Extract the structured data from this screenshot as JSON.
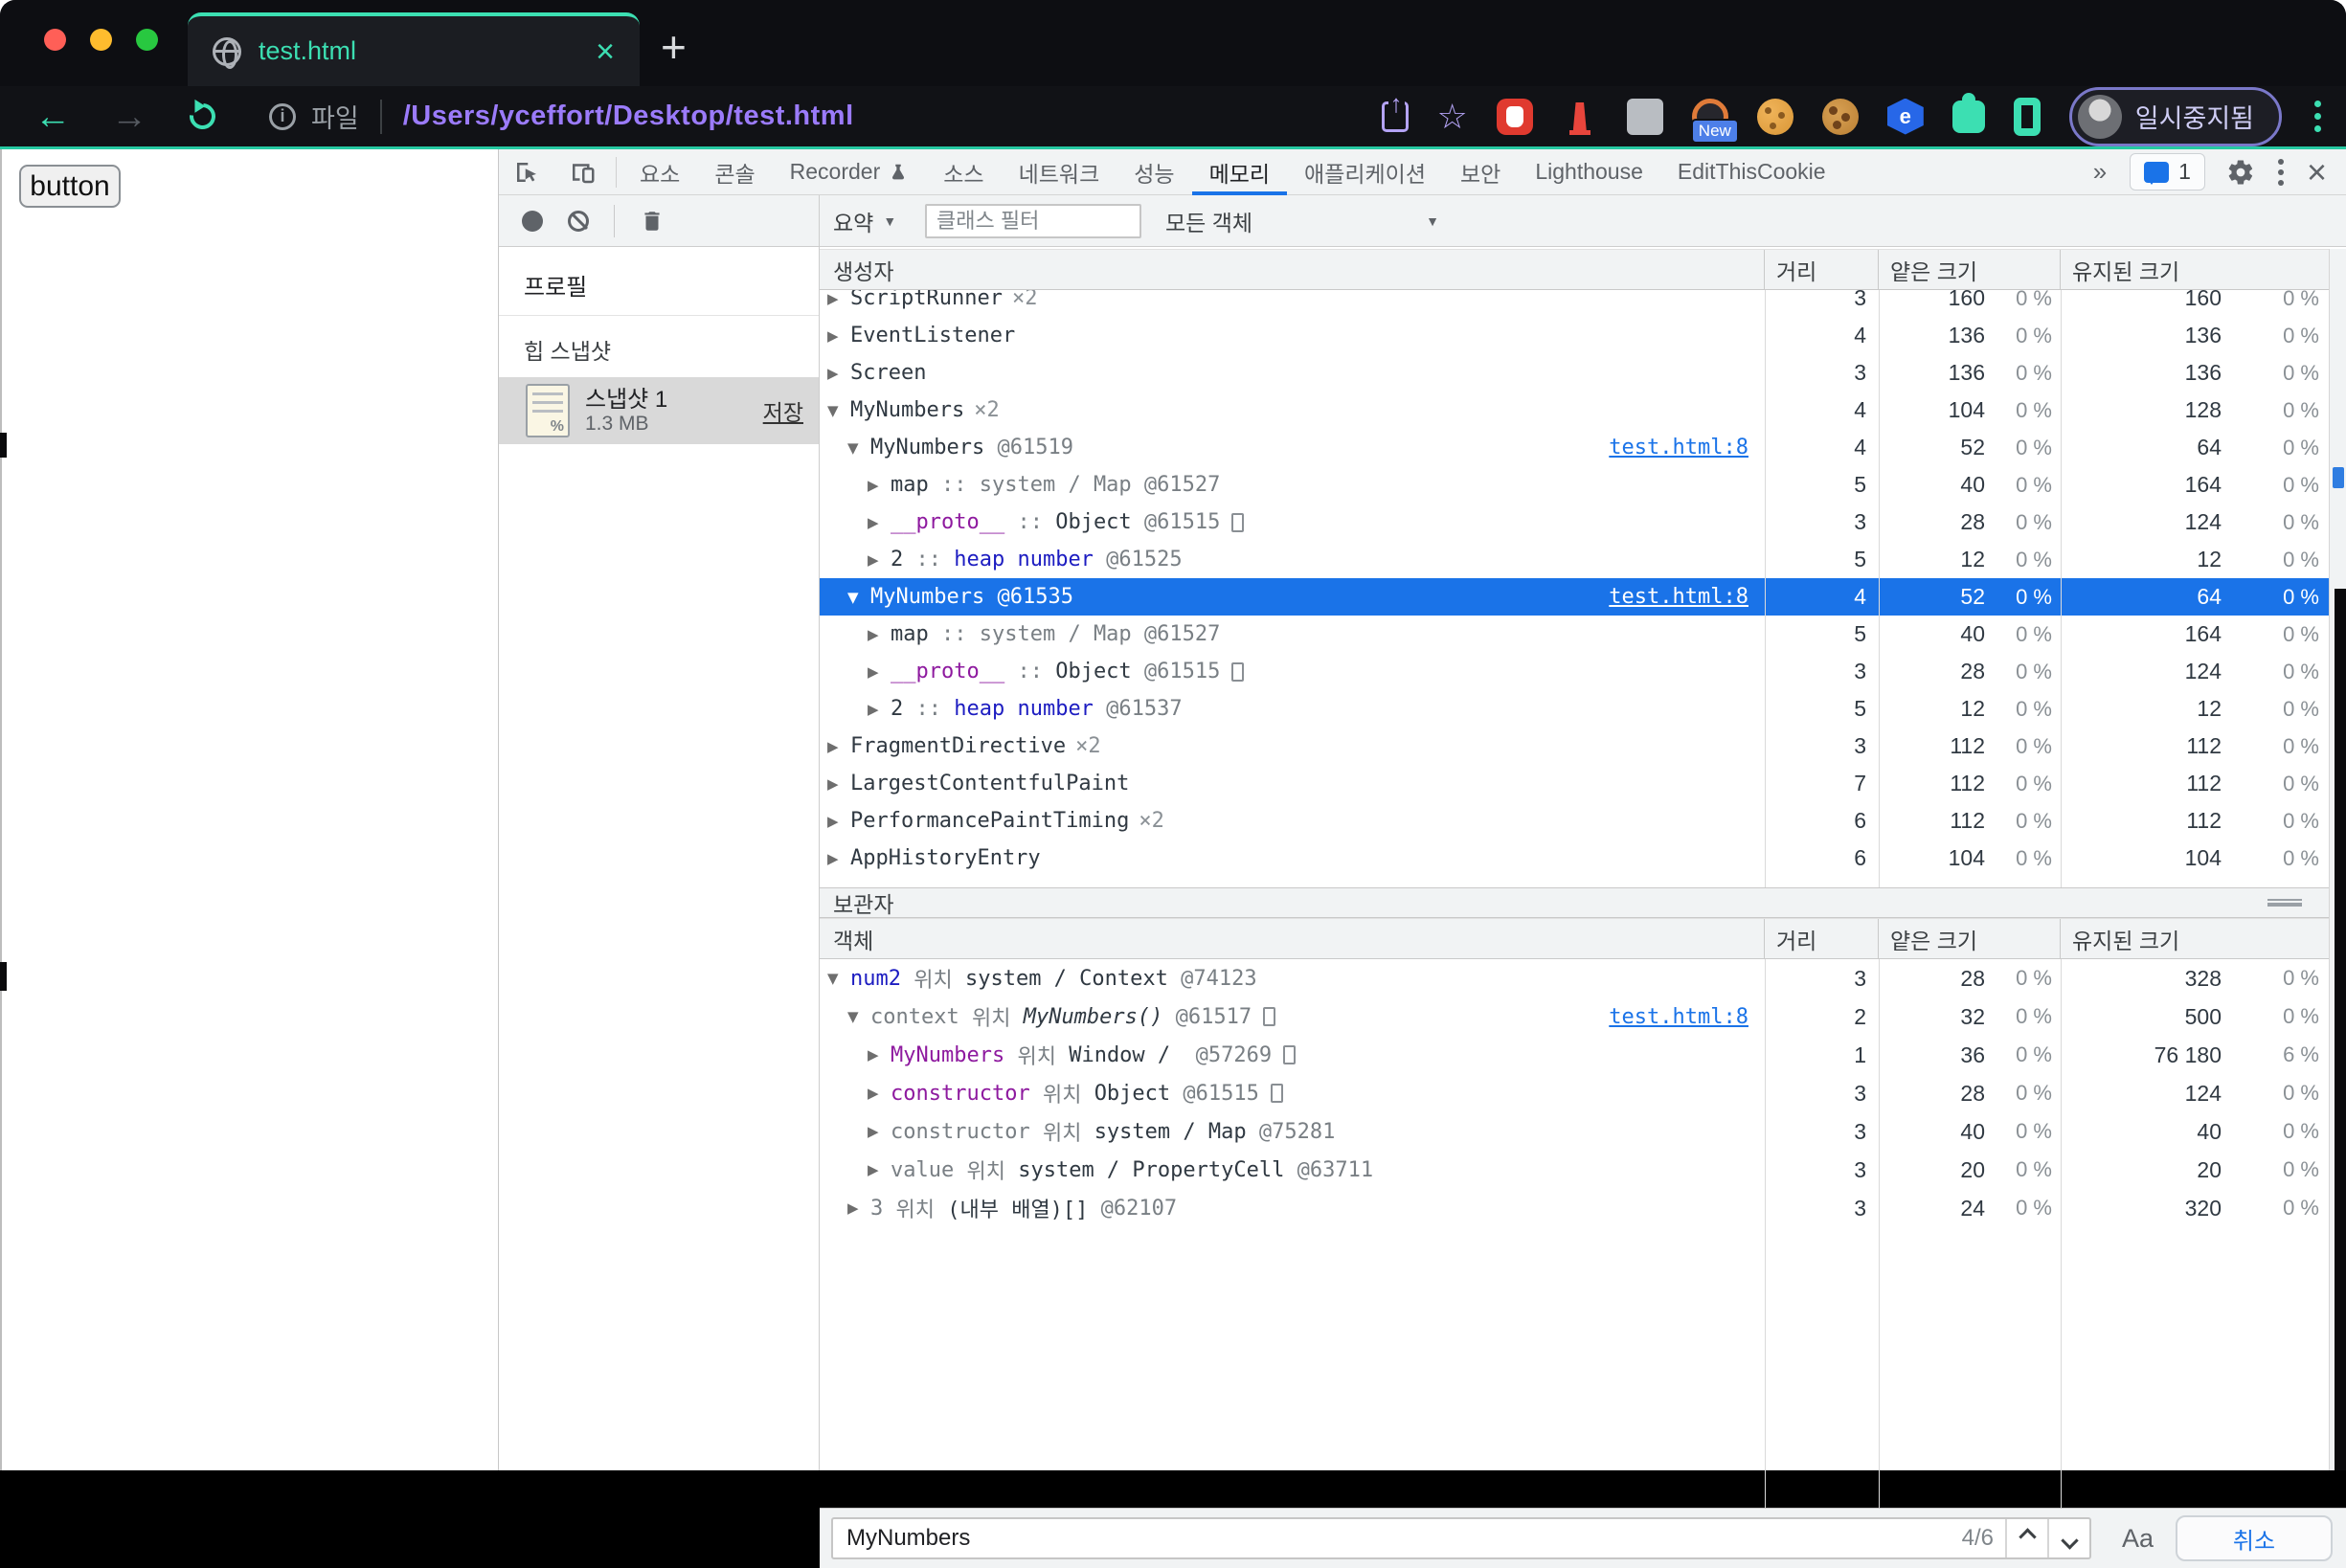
{
  "theme": {
    "accent_teal": "#3cdfb2",
    "url_purple": "#9b7bfa",
    "selection_blue": "#1a73e8"
  },
  "browser": {
    "tab_title": "test.html",
    "tab_close": "×",
    "new_tab_button": "+",
    "file_label": "파일",
    "url": "/Users/yceffort/Desktop/test.html",
    "profile_badge": "일시중지됨",
    "extension_new_badge": "New",
    "hexagon_ext_letter": "e"
  },
  "page": {
    "button_label": "button"
  },
  "devtools": {
    "tabs": [
      {
        "label": "요소"
      },
      {
        "label": "콘솔"
      },
      {
        "label": "Recorder",
        "icon": "flask"
      },
      {
        "label": "소스"
      },
      {
        "label": "네트워크"
      },
      {
        "label": "성능"
      },
      {
        "label": "메모리",
        "selected": true
      },
      {
        "label": "애플리케이션"
      },
      {
        "label": "보안"
      },
      {
        "label": "Lighthouse"
      },
      {
        "label": "EditThisCookie"
      }
    ],
    "overflow_chevron": "»",
    "issues_count": "1",
    "toolbar": {
      "summary_label": "요약",
      "class_filter_placeholder": "클래스 필터",
      "objects_filter_value": "모든 객체"
    },
    "sidebar": {
      "profiles_title": "프로필",
      "heap_snapshots_label": "힙 스냅샷",
      "snapshot_name": "스냅샷 1",
      "snapshot_size": "1.3 MB",
      "save_label": "저장"
    },
    "grid_columns": {
      "constructor": "생성자",
      "object": "객체",
      "distance": "거리",
      "shallow_size": "얕은 크기",
      "retained_size": "유지된 크기"
    },
    "retainers_title": "보관자",
    "constructor_rows": [
      {
        "lvl": 0,
        "arrow": "closed",
        "clipped": true,
        "parts": [
          [
            "ScriptRunner",
            "dk"
          ],
          [
            "×2",
            "cnt"
          ]
        ],
        "dist": "3",
        "shallow": "160",
        "shallow_pct": "0 %",
        "retained": "160",
        "retained_pct": "0 %"
      },
      {
        "lvl": 0,
        "arrow": "closed",
        "parts": [
          [
            "EventListener",
            "dk"
          ]
        ],
        "dist": "4",
        "shallow": "136",
        "shallow_pct": "0 %",
        "retained": "136",
        "retained_pct": "0 %"
      },
      {
        "lvl": 0,
        "arrow": "closed",
        "parts": [
          [
            "Screen",
            "dk"
          ]
        ],
        "dist": "3",
        "shallow": "136",
        "shallow_pct": "0 %",
        "retained": "136",
        "retained_pct": "0 %"
      },
      {
        "lvl": 0,
        "arrow": "open",
        "parts": [
          [
            "MyNumbers",
            "dk"
          ],
          [
            "×2",
            "cnt"
          ]
        ],
        "dist": "4",
        "shallow": "104",
        "shallow_pct": "0 %",
        "retained": "128",
        "retained_pct": "0 %"
      },
      {
        "lvl": 1,
        "arrow": "open",
        "link": "test.html:8",
        "parts": [
          [
            "MyNumbers",
            "dk"
          ],
          [
            " @61519",
            "gray"
          ]
        ],
        "dist": "4",
        "shallow": "52",
        "shallow_pct": "0 %",
        "retained": "64",
        "retained_pct": "0 %"
      },
      {
        "lvl": 2,
        "arrow": "closed",
        "parts": [
          [
            "map",
            "dk"
          ],
          [
            " :: ",
            "gray"
          ],
          [
            "system / Map",
            "gray"
          ],
          [
            " @61527",
            "gray"
          ]
        ],
        "dist": "5",
        "shallow": "40",
        "shallow_pct": "0 %",
        "retained": "164",
        "retained_pct": "0 %"
      },
      {
        "lvl": 2,
        "arrow": "closed",
        "box": true,
        "parts": [
          [
            "__proto__",
            "mag"
          ],
          [
            " :: ",
            "gray"
          ],
          [
            "Object",
            "dk"
          ],
          [
            " @61515",
            "gray"
          ]
        ],
        "dist": "3",
        "shallow": "28",
        "shallow_pct": "0 %",
        "retained": "124",
        "retained_pct": "0 %"
      },
      {
        "lvl": 2,
        "arrow": "closed",
        "parts": [
          [
            "2",
            "dk"
          ],
          [
            " :: ",
            "gray"
          ],
          [
            "heap number",
            "navy"
          ],
          [
            " @61525",
            "gray"
          ]
        ],
        "dist": "5",
        "shallow": "12",
        "shallow_pct": "0 %",
        "retained": "12",
        "retained_pct": "0 %"
      },
      {
        "lvl": 1,
        "arrow": "open",
        "selected": true,
        "link": "test.html:8",
        "parts": [
          [
            "MyNumbers",
            "dk"
          ],
          [
            " @61535",
            "gray"
          ]
        ],
        "dist": "4",
        "shallow": "52",
        "shallow_pct": "0 %",
        "retained": "64",
        "retained_pct": "0 %"
      },
      {
        "lvl": 2,
        "arrow": "closed",
        "parts": [
          [
            "map",
            "dk"
          ],
          [
            " :: ",
            "gray"
          ],
          [
            "system / Map",
            "gray"
          ],
          [
            " @61527",
            "gray"
          ]
        ],
        "dist": "5",
        "shallow": "40",
        "shallow_pct": "0 %",
        "retained": "164",
        "retained_pct": "0 %"
      },
      {
        "lvl": 2,
        "arrow": "closed",
        "box": true,
        "parts": [
          [
            "__proto__",
            "mag"
          ],
          [
            " :: ",
            "gray"
          ],
          [
            "Object",
            "dk"
          ],
          [
            " @61515",
            "gray"
          ]
        ],
        "dist": "3",
        "shallow": "28",
        "shallow_pct": "0 %",
        "retained": "124",
        "retained_pct": "0 %"
      },
      {
        "lvl": 2,
        "arrow": "closed",
        "parts": [
          [
            "2",
            "dk"
          ],
          [
            " :: ",
            "gray"
          ],
          [
            "heap number",
            "navy"
          ],
          [
            " @61537",
            "gray"
          ]
        ],
        "dist": "5",
        "shallow": "12",
        "shallow_pct": "0 %",
        "retained": "12",
        "retained_pct": "0 %"
      },
      {
        "lvl": 0,
        "arrow": "closed",
        "parts": [
          [
            "FragmentDirective",
            "dk"
          ],
          [
            "×2",
            "cnt"
          ]
        ],
        "dist": "3",
        "shallow": "112",
        "shallow_pct": "0 %",
        "retained": "112",
        "retained_pct": "0 %"
      },
      {
        "lvl": 0,
        "arrow": "closed",
        "parts": [
          [
            "LargestContentfulPaint",
            "dk"
          ]
        ],
        "dist": "7",
        "shallow": "112",
        "shallow_pct": "0 %",
        "retained": "112",
        "retained_pct": "0 %"
      },
      {
        "lvl": 0,
        "arrow": "closed",
        "parts": [
          [
            "PerformancePaintTiming",
            "dk"
          ],
          [
            "×2",
            "cnt"
          ]
        ],
        "dist": "6",
        "shallow": "112",
        "shallow_pct": "0 %",
        "retained": "112",
        "retained_pct": "0 %"
      },
      {
        "lvl": 0,
        "arrow": "closed",
        "parts": [
          [
            "AppHistoryEntry",
            "dk"
          ]
        ],
        "dist": "6",
        "shallow": "104",
        "shallow_pct": "0 %",
        "retained": "104",
        "retained_pct": "0 %"
      }
    ],
    "retainer_rows": [
      {
        "lvl": 0,
        "arrow": "open",
        "parts": [
          [
            "num2",
            "navy"
          ],
          [
            " 위치 ",
            "gray"
          ],
          [
            "system / Context",
            "dk"
          ],
          [
            " @74123",
            "gray"
          ]
        ],
        "dist": "3",
        "shallow": "28",
        "shallow_pct": "0 %",
        "retained": "328",
        "retained_pct": "0 %"
      },
      {
        "lvl": 1,
        "arrow": "open",
        "box": true,
        "link": "test.html:8",
        "parts": [
          [
            "context",
            "gray"
          ],
          [
            " 위치 ",
            "gray"
          ],
          [
            "MyNumbers()",
            "it"
          ],
          [
            " @61517",
            "gray"
          ]
        ],
        "dist": "2",
        "shallow": "32",
        "shallow_pct": "0 %",
        "retained": "500",
        "retained_pct": "0 %"
      },
      {
        "lvl": 2,
        "arrow": "closed",
        "box": true,
        "parts": [
          [
            "MyNumbers",
            "mag"
          ],
          [
            " 위치 ",
            "gray"
          ],
          [
            "Window /",
            "dk"
          ],
          [
            "  @57269",
            "gray"
          ]
        ],
        "dist": "1",
        "shallow": "36",
        "shallow_pct": "0 %",
        "retained": "76 180",
        "retained_pct": "6 %"
      },
      {
        "lvl": 2,
        "arrow": "closed",
        "box": true,
        "parts": [
          [
            "constructor",
            "mag"
          ],
          [
            " 위치 ",
            "gray"
          ],
          [
            "Object",
            "dk"
          ],
          [
            " @61515",
            "gray"
          ]
        ],
        "dist": "3",
        "shallow": "28",
        "shallow_pct": "0 %",
        "retained": "124",
        "retained_pct": "0 %"
      },
      {
        "lvl": 2,
        "arrow": "closed",
        "parts": [
          [
            "constructor",
            "gray"
          ],
          [
            " 위치 ",
            "gray"
          ],
          [
            "system / Map",
            "dk"
          ],
          [
            " @75281",
            "gray"
          ]
        ],
        "dist": "3",
        "shallow": "40",
        "shallow_pct": "0 %",
        "retained": "40",
        "retained_pct": "0 %"
      },
      {
        "lvl": 2,
        "arrow": "closed",
        "parts": [
          [
            "value",
            "gray"
          ],
          [
            " 위치 ",
            "gray"
          ],
          [
            "system / PropertyCell",
            "dk"
          ],
          [
            " @63711",
            "gray"
          ]
        ],
        "dist": "3",
        "shallow": "20",
        "shallow_pct": "0 %",
        "retained": "20",
        "retained_pct": "0 %"
      },
      {
        "lvl": 1,
        "arrow": "closed",
        "parts": [
          [
            "3",
            "gray"
          ],
          [
            " 위치 ",
            "gray"
          ],
          [
            "(내부 배열)[]",
            "dk"
          ],
          [
            " @62107",
            "gray"
          ]
        ],
        "dist": "3",
        "shallow": "24",
        "shallow_pct": "0 %",
        "retained": "320",
        "retained_pct": "0 %"
      }
    ],
    "search": {
      "value": "MyNumbers",
      "counter": "4/6",
      "match_case_label": "Aa",
      "cancel_label": "취소"
    }
  }
}
